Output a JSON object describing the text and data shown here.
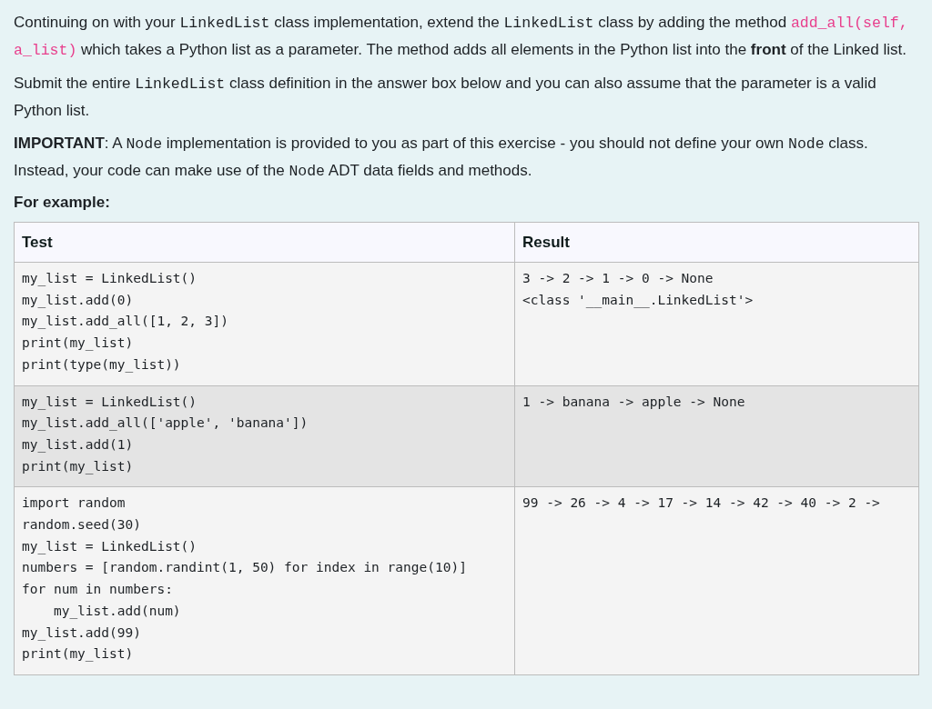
{
  "paragraphs": [
    [
      {
        "kind": "plain",
        "text": "Continuing on with your "
      },
      {
        "kind": "code",
        "text": "LinkedList"
      },
      {
        "kind": "plain",
        "text": " class implementation, extend the "
      },
      {
        "kind": "code",
        "text": "LinkedList"
      },
      {
        "kind": "plain",
        "text": " class by adding the method "
      },
      {
        "kind": "code_highlight",
        "text": "add_all(self, a_list)"
      },
      {
        "kind": "plain",
        "text": " which takes a Python list as a parameter. The method adds all elements in the Python list into the "
      },
      {
        "kind": "bold",
        "text": "front"
      },
      {
        "kind": "plain",
        "text": " of the Linked list."
      }
    ],
    [
      {
        "kind": "plain",
        "text": "Submit the entire "
      },
      {
        "kind": "code",
        "text": "LinkedList"
      },
      {
        "kind": "plain",
        "text": " class definition in the answer box below and you can also assume that the parameter is a valid Python list."
      }
    ],
    [
      {
        "kind": "bold",
        "text": "IMPORTANT"
      },
      {
        "kind": "plain",
        "text": ": A "
      },
      {
        "kind": "code",
        "text": "Node"
      },
      {
        "kind": "plain",
        "text": " implementation is provided to you as part of this exercise - you should not define your own "
      },
      {
        "kind": "code",
        "text": "Node"
      },
      {
        "kind": "plain",
        "text": " class. Instead, your code can make use of the "
      },
      {
        "kind": "code",
        "text": "Node"
      },
      {
        "kind": "plain",
        "text": " ADT data fields and methods."
      }
    ]
  ],
  "example_heading": "For example:",
  "table": {
    "columns": [
      "Test",
      "Result"
    ],
    "rows": [
      {
        "test": [
          "my_list = LinkedList()",
          "my_list.add(0)",
          "my_list.add_all([1, 2, 3])",
          "print(my_list)",
          "print(type(my_list))"
        ],
        "result": [
          "3 -> 2 -> 1 -> 0 -> None",
          "<class '__main__.LinkedList'>"
        ]
      },
      {
        "test": [
          "my_list = LinkedList()",
          "my_list.add_all(['apple', 'banana'])",
          "my_list.add(1)",
          "print(my_list)"
        ],
        "result": [
          "1 -> banana -> apple -> None"
        ]
      },
      {
        "test": [
          "import random",
          "random.seed(30)",
          "my_list = LinkedList()",
          "numbers = [random.randint(1, 50) for index in range(10)]",
          "for num in numbers:",
          "    my_list.add(num)",
          "my_list.add(99)",
          "print(my_list)"
        ],
        "result": [
          "99 -> 26 -> 4 -> 17 -> 14 -> 42 -> 40 -> 2 ->"
        ]
      }
    ]
  }
}
